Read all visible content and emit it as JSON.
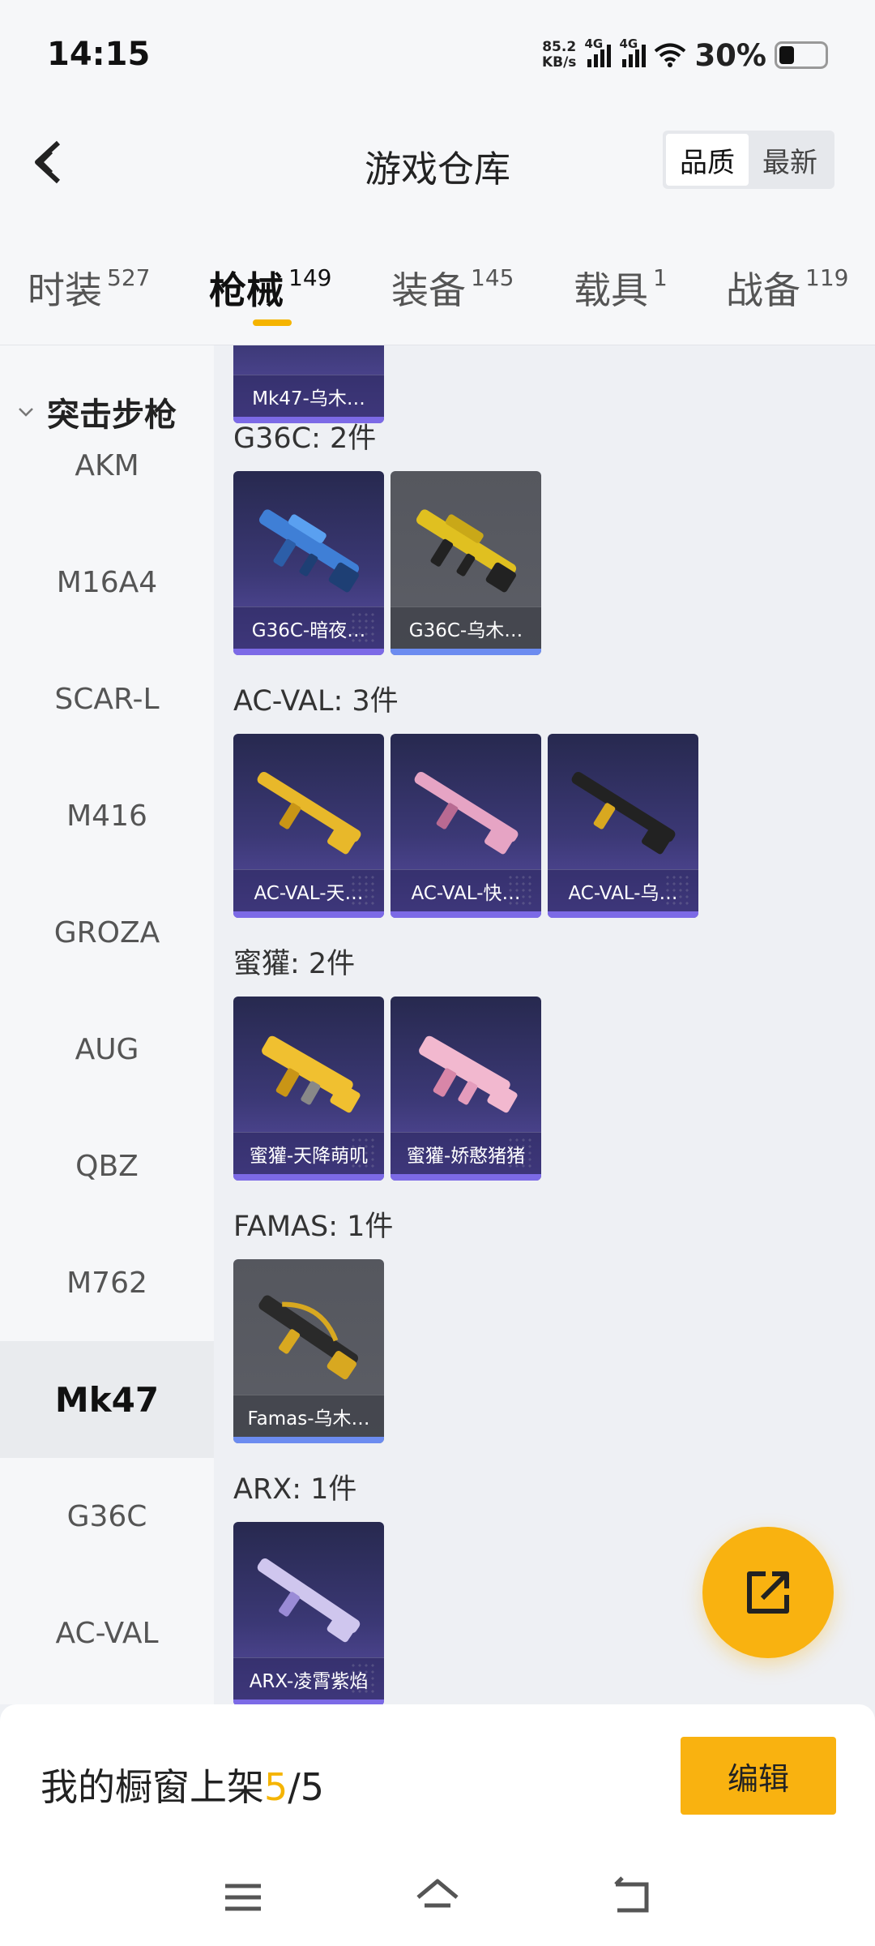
{
  "status": {
    "time": "14:15",
    "speed_value": "85.2",
    "speed_unit": "KB/s",
    "sim1": "4G",
    "sim2": "4G",
    "battery": "30%"
  },
  "header": {
    "title": "游戏仓库",
    "sort_quality": "品质",
    "sort_latest": "最新"
  },
  "tabs": [
    {
      "label": "时装",
      "count": "527"
    },
    {
      "label": "枪械",
      "count": "149"
    },
    {
      "label": "装备",
      "count": "145"
    },
    {
      "label": "载具",
      "count": "1"
    },
    {
      "label": "战备",
      "count": "119"
    }
  ],
  "sidebar": {
    "group": "突击步枪",
    "items": [
      "AKM",
      "M16A4",
      "SCAR-L",
      "M416",
      "GROZA",
      "AUG",
      "QBZ",
      "M762",
      "Mk47",
      "G36C",
      "AC-VAL"
    ]
  },
  "sections": [
    {
      "title": "",
      "items": [
        {
          "name": "Mk47-乌木…",
          "rarity": "purple",
          "icon": "rifle-icon"
        }
      ]
    },
    {
      "title": "G36C: 2件",
      "items": [
        {
          "name": "G36C-暗夜…",
          "rarity": "purple",
          "icon": "rifle-icon"
        },
        {
          "name": "G36C-乌木…",
          "rarity": "grey",
          "icon": "rifle-icon"
        }
      ]
    },
    {
      "title": "AC-VAL: 3件",
      "items": [
        {
          "name": "AC-VAL-天…",
          "rarity": "purple",
          "icon": "rifle-icon"
        },
        {
          "name": "AC-VAL-快…",
          "rarity": "purple",
          "icon": "rifle-icon"
        },
        {
          "name": "AC-VAL-乌…",
          "rarity": "purple",
          "icon": "rifle-icon"
        }
      ]
    },
    {
      "title": "蜜獾: 2件",
      "items": [
        {
          "name": "蜜獾-天降萌叽",
          "rarity": "purple",
          "icon": "rifle-icon"
        },
        {
          "name": "蜜獾-娇憨猪猪",
          "rarity": "purple",
          "icon": "rifle-icon"
        }
      ]
    },
    {
      "title": "FAMAS: 1件",
      "items": [
        {
          "name": "Famas-乌木…",
          "rarity": "grey",
          "icon": "rifle-icon"
        }
      ]
    },
    {
      "title": "ARX: 1件",
      "items": [
        {
          "name": "ARX-凌霄紫焰",
          "rarity": "purple",
          "icon": "rifle-icon"
        }
      ]
    }
  ],
  "shelf": {
    "label": "我的橱窗上架",
    "current": "5",
    "sep_total": "/5"
  },
  "edit_label": "编辑",
  "colors": {
    "accent": "#f9b210",
    "purple_card": "#3b3875",
    "grey_card": "#5c5e66"
  }
}
